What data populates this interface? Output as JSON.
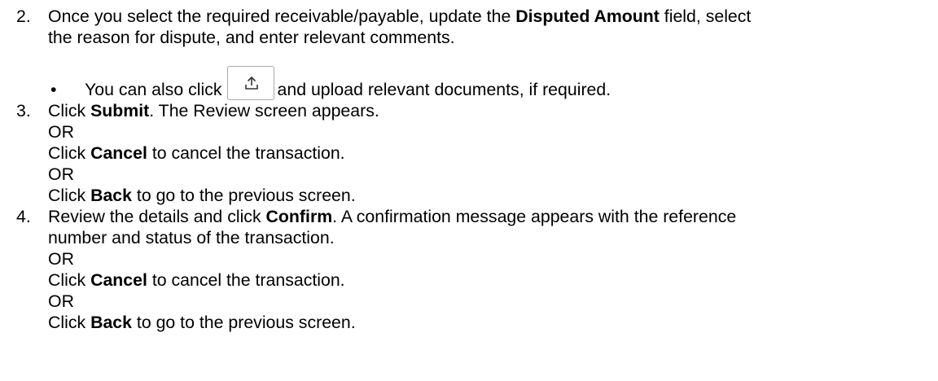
{
  "steps": [
    {
      "number": "2.",
      "line1": {
        "pre": "Once you select the required receivable/payable, update the ",
        "bold": "Disputed Amount",
        "post": " field, select"
      },
      "line2": "the reason for dispute, and enter relevant comments.",
      "bullet": {
        "symbol": "•",
        "pre": "You can also click",
        "icon": "upload-icon",
        "post": "and upload relevant documents, if required."
      }
    },
    {
      "number": "3.",
      "line1": {
        "pre": "Click ",
        "bold": "Submit",
        "post": ". The Review screen appears."
      },
      "or1": "OR",
      "line2": {
        "pre": "Click ",
        "bold": "Cancel",
        "post": " to cancel the transaction."
      },
      "or2": "OR",
      "line3": {
        "pre": "Click ",
        "bold": "Back",
        "post": " to go to the previous screen."
      }
    },
    {
      "number": "4.",
      "line1": {
        "pre": "Review the details and click ",
        "bold": "Confirm",
        "post": ". A confirmation message appears with the reference"
      },
      "line1b": "number and status of the transaction.",
      "or1": "OR",
      "line2": {
        "pre": "Click ",
        "bold": "Cancel",
        "post": " to cancel the transaction."
      },
      "or2": "OR",
      "line3": {
        "pre": "Click ",
        "bold": "Back",
        "post": " to go to the previous screen."
      }
    }
  ]
}
